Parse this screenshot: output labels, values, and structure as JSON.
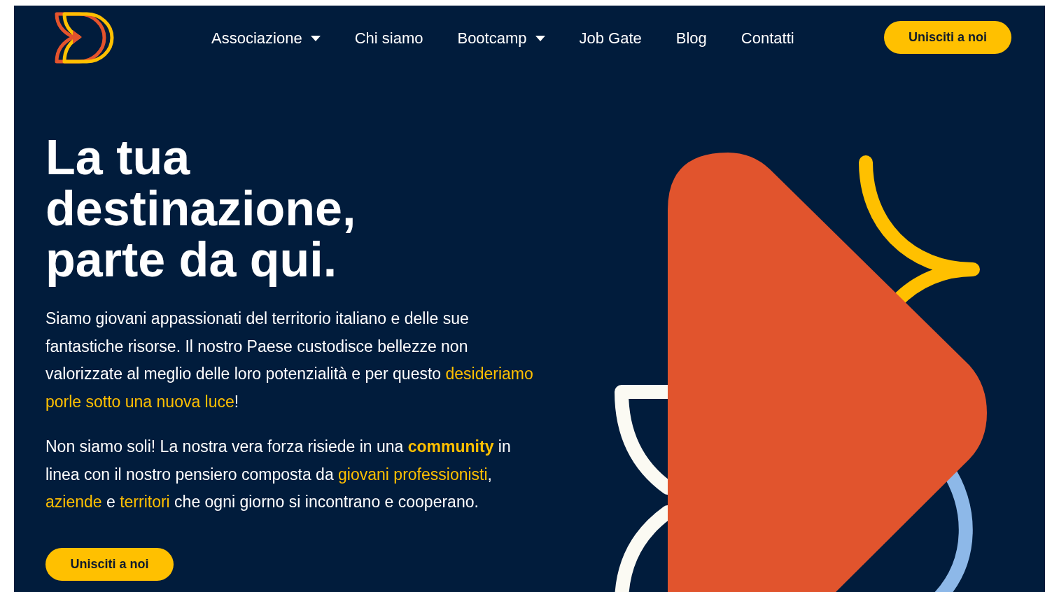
{
  "nav": {
    "items": [
      {
        "label": "Associazione",
        "dropdown": true
      },
      {
        "label": "Chi siamo",
        "dropdown": false
      },
      {
        "label": "Bootcamp",
        "dropdown": true
      },
      {
        "label": "Job Gate",
        "dropdown": false
      },
      {
        "label": "Blog",
        "dropdown": false
      },
      {
        "label": "Contatti",
        "dropdown": false
      }
    ],
    "cta": "Unisciti a noi"
  },
  "hero": {
    "heading": [
      "La tua",
      "destinazione,",
      "parte da qui."
    ],
    "paragraphs": [
      [
        {
          "text": "Siamo giovani appassionati del territorio italiano e delle sue fantastiche risorse. Il nostro Paese custodisce bellezze non valorizzate al meglio delle loro potenzialità e per questo ",
          "accent": false
        },
        {
          "text": "desideriamo porle sotto una nuova luce",
          "accent": true
        },
        {
          "text": "!",
          "accent": false
        }
      ],
      [
        {
          "text": "Non siamo soli! La nostra vera forza risiede in una ",
          "accent": false
        },
        {
          "text": "**community**",
          "accent": true
        },
        {
          "text": " in linea con il nostro pensiero composta da ",
          "accent": false
        },
        {
          "text": "giovani professionisti",
          "accent": true
        },
        {
          "text": ", ",
          "accent": false
        },
        {
          "text": "aziende",
          "accent": true
        },
        {
          "text": " e ",
          "accent": false
        },
        {
          "text": "territori",
          "accent": true
        },
        {
          "text": " che ogni giorno si incontrano e cooperano.",
          "accent": false
        }
      ]
    ],
    "button": "Unisciti a noi"
  }
}
